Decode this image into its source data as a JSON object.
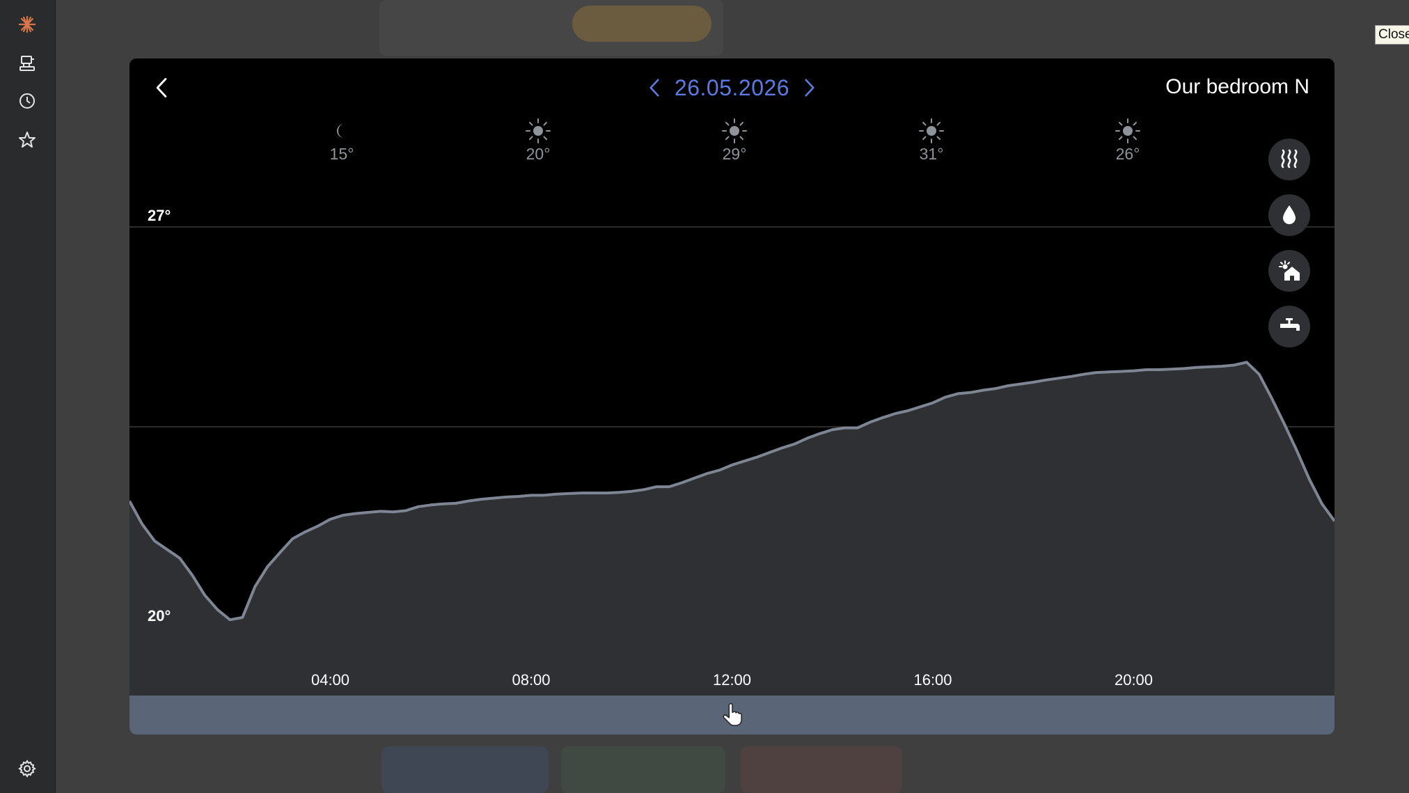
{
  "window": {
    "close_label": "Close"
  },
  "sidebar": {
    "items": [
      {
        "name": "logo",
        "icon": "sun-logo-icon"
      },
      {
        "name": "devices",
        "icon": "devices-icon"
      },
      {
        "name": "history",
        "icon": "clock-icon"
      },
      {
        "name": "favorites",
        "icon": "star-icon"
      }
    ],
    "settings_icon": "gear-icon"
  },
  "dialog": {
    "date": "26.05.2026",
    "room": "Our bedroom N",
    "weather": [
      {
        "icon": "moon-icon",
        "temp": "15°"
      },
      {
        "icon": "sun-icon",
        "temp": "20°"
      },
      {
        "icon": "sun-icon",
        "temp": "29°"
      },
      {
        "icon": "sun-icon",
        "temp": "31°"
      },
      {
        "icon": "sun-icon",
        "temp": "26°"
      }
    ],
    "mode_buttons": [
      "heating-icon",
      "humidity-icon",
      "outdoor-icon",
      "hot-water-icon"
    ],
    "accent_color": "#5b7be0"
  },
  "chart_data": {
    "type": "area",
    "y_tick_labels": [
      "27°",
      "20°"
    ],
    "ylim": [
      20,
      27
    ],
    "xlim": [
      0,
      24
    ],
    "x_tick_labels": [
      "04:00",
      "08:00",
      "12:00",
      "16:00",
      "20:00"
    ],
    "x_ticks": [
      4,
      8,
      12,
      16,
      20
    ],
    "grid": true,
    "line_color": "#7e8694",
    "fill_color": "#2f3033",
    "x": [
      0,
      0.25,
      0.5,
      0.75,
      1,
      1.25,
      1.5,
      1.75,
      2,
      2.25,
      2.5,
      2.75,
      3,
      3.25,
      3.5,
      3.75,
      4,
      4.25,
      4.5,
      4.75,
      5,
      5.25,
      5.5,
      5.75,
      6,
      6.25,
      6.5,
      6.75,
      7,
      7.25,
      7.5,
      7.75,
      8,
      8.25,
      8.5,
      8.75,
      9,
      9.25,
      9.5,
      9.75,
      10,
      10.25,
      10.5,
      10.75,
      11,
      11.25,
      11.5,
      11.75,
      12,
      12.25,
      12.5,
      12.75,
      13,
      13.25,
      13.5,
      13.75,
      14,
      14.25,
      14.5,
      14.75,
      15,
      15.25,
      15.5,
      15.75,
      16,
      16.25,
      16.5,
      16.75,
      17,
      17.25,
      17.5,
      17.75,
      18,
      18.25,
      18.5,
      18.75,
      19,
      19.25,
      19.5,
      19.75,
      20,
      20.25,
      20.5,
      20.75,
      21,
      21.25,
      21.5,
      21.75,
      22,
      22.25,
      22.5,
      22.75,
      23,
      23.25,
      23.5,
      23.75,
      24
    ],
    "values": [
      22.2,
      21.8,
      21.5,
      21.35,
      21.2,
      20.9,
      20.55,
      20.3,
      20.12,
      20.16,
      20.7,
      21.05,
      21.3,
      21.54,
      21.66,
      21.76,
      21.88,
      21.95,
      21.98,
      22.0,
      22.02,
      22.01,
      22.03,
      22.1,
      22.13,
      22.15,
      22.16,
      22.2,
      22.23,
      22.25,
      22.27,
      22.28,
      22.3,
      22.3,
      22.32,
      22.33,
      22.34,
      22.34,
      22.34,
      22.35,
      22.37,
      22.4,
      22.45,
      22.45,
      22.52,
      22.6,
      22.68,
      22.74,
      22.83,
      22.9,
      22.97,
      23.05,
      23.13,
      23.2,
      23.3,
      23.38,
      23.45,
      23.48,
      23.48,
      23.58,
      23.66,
      23.73,
      23.78,
      23.85,
      23.92,
      24.02,
      24.08,
      24.1,
      24.14,
      24.17,
      24.22,
      24.25,
      24.28,
      24.32,
      24.35,
      24.38,
      24.42,
      24.45,
      24.46,
      24.47,
      24.48,
      24.5,
      24.5,
      24.51,
      24.52,
      24.54,
      24.55,
      24.56,
      24.58,
      24.63,
      24.42,
      24.0,
      23.55,
      23.08,
      22.58,
      22.15,
      21.85
    ]
  }
}
